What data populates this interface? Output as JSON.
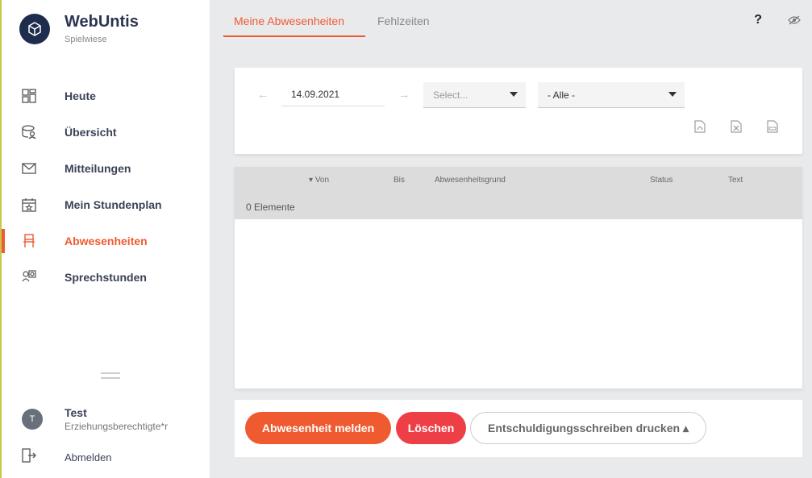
{
  "app": {
    "title": "WebUntis",
    "subtitle": "Spielwiese"
  },
  "sidebar": {
    "items": [
      {
        "label": "Heute",
        "icon": "dashboard-icon"
      },
      {
        "label": "Übersicht",
        "icon": "overview-icon"
      },
      {
        "label": "Mitteilungen",
        "icon": "mail-icon"
      },
      {
        "label": "Mein Stundenplan",
        "icon": "calendar-icon"
      },
      {
        "label": "Abwesenheiten",
        "icon": "chair-icon",
        "active": true
      },
      {
        "label": "Sprechstunden",
        "icon": "office-hours-icon"
      }
    ],
    "user": {
      "initial": "T",
      "name": "Test",
      "role": "Erziehungsberechtigte*r"
    },
    "logout_label": "Abmelden"
  },
  "tabs": [
    {
      "label": "Meine Abwesenheiten",
      "active": true
    },
    {
      "label": "Fehlzeiten",
      "active": false
    }
  ],
  "header": {
    "help": "?"
  },
  "filter": {
    "date": "14.09.2021",
    "select1": "Select...",
    "select2": "- Alle -"
  },
  "table": {
    "columns": [
      "Von",
      "Bis",
      "Abwesenheitsgrund",
      "Status",
      "Text"
    ],
    "count": "0 Elemente"
  },
  "actions": {
    "report": "Abwesenheit melden",
    "delete": "Löschen",
    "print": "Entschuldigungsschreiben drucken ▴"
  },
  "colors": {
    "accent": "#f05a30",
    "danger": "#ee3f47",
    "brand": "#1e2c4e"
  }
}
